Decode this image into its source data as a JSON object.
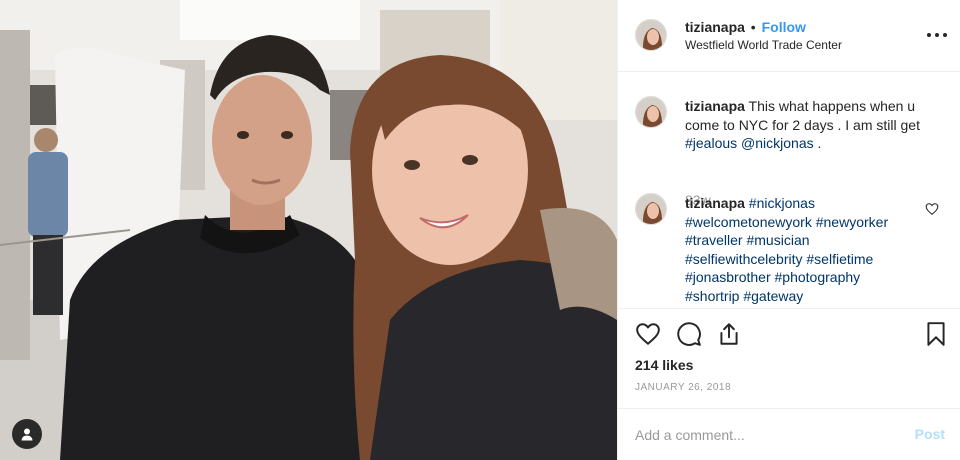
{
  "post": {
    "username": "tizianapa",
    "follow_label": "Follow",
    "separator": "•",
    "location": "Westfield World Trade Center",
    "caption_text": "This what happens when u come to NYC for 2 days . I am still get",
    "caption_tag1": "#jealous",
    "caption_tag2": "@nickjonas",
    "caption_end": ".",
    "caption_age": "83w",
    "likes": "214 likes",
    "date": "JANUARY 26, 2018",
    "comment_placeholder": "Add a comment...",
    "post_label": "Post"
  },
  "comment": {
    "username": "tizianapa",
    "tags": [
      "#nickjonas",
      "#welcometonewyork",
      "#newyorker",
      "#traveller",
      "#musician",
      "#selfiewithcelebrity",
      "#selfietime",
      "#jonasbrother",
      "#photography",
      "#shortrip",
      "#gateway"
    ]
  },
  "icons": {
    "more": "more-options-icon",
    "like": "heart-icon",
    "comment": "comment-icon",
    "share": "share-icon",
    "save": "bookmark-icon",
    "tag_user": "user-tag-icon"
  },
  "colors": {
    "link": "#3897f0",
    "hashtag": "#003569",
    "muted": "#999999",
    "post_disabled": "#b2dffc"
  }
}
